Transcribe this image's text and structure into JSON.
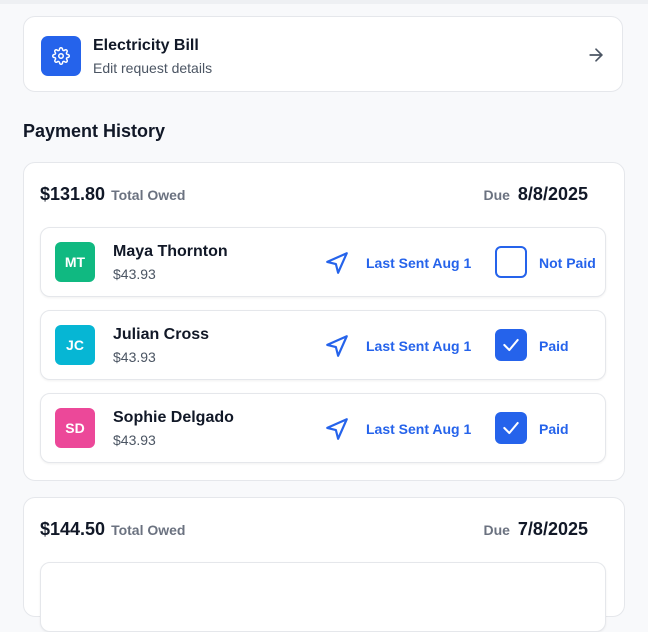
{
  "bill": {
    "title": "Electricity Bill",
    "subtitle": "Edit request details",
    "icon": "gear-icon",
    "action_icon": "arrow-right-icon"
  },
  "section": {
    "title": "Payment History"
  },
  "colors": {
    "accent": "#2563eb",
    "avatar_mt": "#10b981",
    "avatar_jc": "#06b6d4",
    "avatar_sd": "#ec4899"
  },
  "periods": [
    {
      "total": "$131.80",
      "total_label": "Total Owed",
      "due_label": "Due",
      "due_date": "8/8/2025",
      "members": [
        {
          "initials": "MT",
          "name": "Maya Thornton",
          "amount": "$43.93",
          "sent": "Last Sent Aug 1",
          "paid": false,
          "status": "Not Paid"
        },
        {
          "initials": "JC",
          "name": "Julian Cross",
          "amount": "$43.93",
          "sent": "Last Sent Aug 1",
          "paid": true,
          "status": "Paid"
        },
        {
          "initials": "SD",
          "name": "Sophie Delgado",
          "amount": "$43.93",
          "sent": "Last Sent Aug 1",
          "paid": true,
          "status": "Paid"
        }
      ]
    },
    {
      "total": "$144.50",
      "total_label": "Total Owed",
      "due_label": "Due",
      "due_date": "7/8/2025"
    }
  ]
}
